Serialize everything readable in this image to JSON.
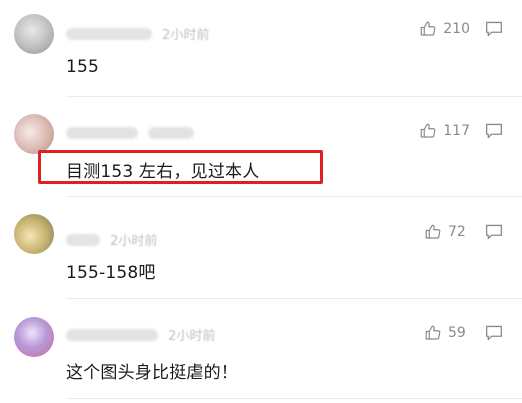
{
  "comments": [
    {
      "text": "155",
      "likes": "210",
      "time": "2小时前"
    },
    {
      "text": "目测153 左右，见过本人",
      "likes": "117"
    },
    {
      "text": "155-158吧",
      "likes": "72",
      "time": "2小时前"
    },
    {
      "text": "这个图头身比挺虐的！",
      "likes": "59",
      "time": "2小时前"
    }
  ],
  "icons": {
    "like": "thumbs-up-icon",
    "reply": "comment-bubble-icon"
  },
  "colors": {
    "highlight_border": "#e02020",
    "meta": "#b8b8b8",
    "count": "#8a8a8a"
  }
}
